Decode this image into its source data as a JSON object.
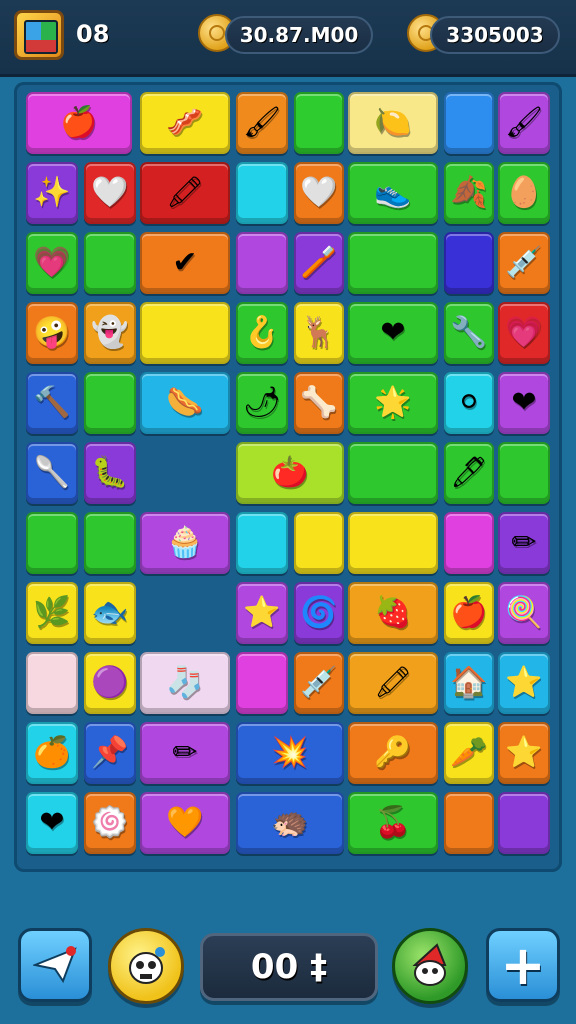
{
  "header": {
    "level": "08",
    "currency_1": "30.87.M00",
    "currency_2": "3305003"
  },
  "footer": {
    "score": "00 ‡",
    "share_icon": "paper-plane-icon",
    "character_icon": "cartoon-face-icon",
    "bonus_icon": "gnome-face-icon",
    "plus_label": "+"
  },
  "board": {
    "tiles": [
      {
        "c": "#e040e0",
        "i": "🍎",
        "n": "apple"
      },
      {
        "c": "#f7e21c",
        "i": "🥓",
        "n": "bacon"
      },
      {
        "c": "#f08a1c",
        "i": "🖌",
        "n": "brush"
      },
      {
        "c": "#2ecc2e",
        "i": "",
        "n": "empty"
      },
      {
        "c": "#f8e88a",
        "i": "🍋",
        "n": "lemon"
      },
      {
        "c": "#2e8ef0",
        "i": "",
        "n": "empty"
      },
      {
        "c": "#b048e0",
        "i": "🖌",
        "n": "brush"
      },
      {
        "c": "#8a3ad8",
        "i": "✨",
        "n": "splat"
      },
      {
        "c": "#e02828",
        "i": "🤍",
        "n": "heart"
      },
      {
        "c": "#d42020",
        "i": "🖍",
        "n": "crayon"
      },
      {
        "c": "#22d2e8",
        "i": "",
        "n": "empty"
      },
      {
        "c": "#f07a1a",
        "i": "🤍",
        "n": "heart"
      },
      {
        "c": "#2ec82e",
        "i": "👟",
        "n": "shoe"
      },
      {
        "c": "#2ec82e",
        "i": "🍂",
        "n": "leaf"
      },
      {
        "c": "#2ec82e",
        "i": "🥚",
        "n": "egg"
      },
      {
        "c": "#2ec82e",
        "i": "💗",
        "n": "heart"
      },
      {
        "c": "#2ec82e",
        "i": "",
        "n": "empty"
      },
      {
        "c": "#f07a1a",
        "i": "✔",
        "n": "check"
      },
      {
        "c": "#b048e0",
        "i": "",
        "n": "empty"
      },
      {
        "c": "#8a3ad8",
        "i": "🪥",
        "n": "brush"
      },
      {
        "c": "#2ec82e",
        "i": "",
        "n": "empty"
      },
      {
        "c": "#3a30d8",
        "i": "",
        "n": "empty"
      },
      {
        "c": "#f07a1a",
        "i": "💉",
        "n": "dropper"
      },
      {
        "c": "#f07a1a",
        "i": "🤪",
        "n": "face"
      },
      {
        "c": "#f0a01a",
        "i": "👻",
        "n": "ghost"
      },
      {
        "c": "#f7e21c",
        "i": "",
        "n": "empty"
      },
      {
        "c": "#2ec82e",
        "i": "🪝",
        "n": "hook"
      },
      {
        "c": "#f7e21c",
        "i": "🦌",
        "n": "antler"
      },
      {
        "c": "#2ec82e",
        "i": "❤",
        "n": "heart"
      },
      {
        "c": "#2ec82e",
        "i": "🔧",
        "n": "wrench"
      },
      {
        "c": "#e02828",
        "i": "💗",
        "n": "heart"
      },
      {
        "c": "#2a62d8",
        "i": "🔨",
        "n": "hammer"
      },
      {
        "c": "#2ec82e",
        "i": "",
        "n": "empty"
      },
      {
        "c": "#22b6e8",
        "i": "🌭",
        "n": "sausage"
      },
      {
        "c": "#2ec82e",
        "i": "🌶",
        "n": "pepper"
      },
      {
        "c": "#f07a1a",
        "i": "🦴",
        "n": "bone"
      },
      {
        "c": "#2ec82e",
        "i": "🌟",
        "n": "star"
      },
      {
        "c": "#22d2e8",
        "i": "⚪",
        "n": "dots"
      },
      {
        "c": "#b048e0",
        "i": "❤",
        "n": "heart"
      },
      {
        "c": "#2a62d8",
        "i": "🥄",
        "n": "spoon"
      },
      {
        "c": "#8a3ad8",
        "i": "🐛",
        "n": "caterpillar"
      },
      {
        "c": "#a8e02a",
        "i": "🍅",
        "n": "tomato"
      },
      {
        "c": "#2ec82e",
        "i": "",
        "n": "empty"
      },
      {
        "c": "#2ec82e",
        "i": "🖊",
        "n": "pen"
      },
      {
        "c": "#2ec82e",
        "i": "",
        "n": "empty"
      },
      {
        "c": "#2ec82e",
        "i": "",
        "n": "empty"
      },
      {
        "c": "#2ec82e",
        "i": "",
        "n": "empty"
      },
      {
        "c": "#b048e0",
        "i": "🧁",
        "n": "bun"
      },
      {
        "c": "#22d2e8",
        "i": "",
        "n": "empty"
      },
      {
        "c": "#f7e21c",
        "i": "",
        "n": "empty"
      },
      {
        "c": "#f7e21c",
        "i": "",
        "n": "empty"
      },
      {
        "c": "#e040e0",
        "i": "",
        "n": "empty"
      },
      {
        "c": "#8a3ad8",
        "i": "✏",
        "n": "pencil"
      },
      {
        "c": "#f7e21c",
        "i": "🌿",
        "n": "sprig"
      },
      {
        "c": "#f7e21c",
        "i": "🐟",
        "n": "fish"
      },
      {
        "c": "#b048e0",
        "i": "⭐",
        "n": "star-wand"
      },
      {
        "c": "#8a3ad8",
        "i": "🌀",
        "n": "swirl"
      },
      {
        "c": "#f0a01a",
        "i": "🍓",
        "n": "berry"
      },
      {
        "c": "#f7e21c",
        "i": "🍎",
        "n": "apple"
      },
      {
        "c": "#b048e0",
        "i": "🍭",
        "n": "lollipop"
      },
      {
        "c": "#f8d8e0",
        "i": "",
        "n": "empty"
      },
      {
        "c": "#f7e21c",
        "i": "🟣",
        "n": "gem"
      },
      {
        "c": "#f0d8f0",
        "i": "🧦",
        "n": "sock"
      },
      {
        "c": "#e040e0",
        "i": "",
        "n": "empty"
      },
      {
        "c": "#f07a1a",
        "i": "💉",
        "n": "dropper"
      },
      {
        "c": "#f0a01a",
        "i": "🖍",
        "n": "marker"
      },
      {
        "c": "#22b6e8",
        "i": "🏠",
        "n": "house"
      },
      {
        "c": "#22b6e8",
        "i": "⭐",
        "n": "star"
      },
      {
        "c": "#22d2e8",
        "i": "🍊",
        "n": "orange"
      },
      {
        "c": "#2a62d8",
        "i": "📌",
        "n": "pin"
      },
      {
        "c": "#b048e0",
        "i": "✏",
        "n": "pencil"
      },
      {
        "c": "#2a62d8",
        "i": "💥",
        "n": "splat"
      },
      {
        "c": "#f07a1a",
        "i": "🔑",
        "n": "key"
      },
      {
        "c": "#f7e21c",
        "i": "🥕",
        "n": "carrot"
      },
      {
        "c": "#f07a1a",
        "i": "⭐",
        "n": "star"
      },
      {
        "c": "#22d2e8",
        "i": "❤",
        "n": "heart"
      },
      {
        "c": "#f07a1a",
        "i": "🍥",
        "n": "swirl"
      },
      {
        "c": "#b048e0",
        "i": "🧡",
        "n": "heart"
      },
      {
        "c": "#2a62d8",
        "i": "🦔",
        "n": "creature"
      },
      {
        "c": "#2ec82e",
        "i": "🍒",
        "n": "cherry"
      },
      {
        "c": "#f07a1a",
        "i": "",
        "n": "empty"
      },
      {
        "c": "#8a3ad8",
        "i": "",
        "n": "empty"
      }
    ]
  }
}
